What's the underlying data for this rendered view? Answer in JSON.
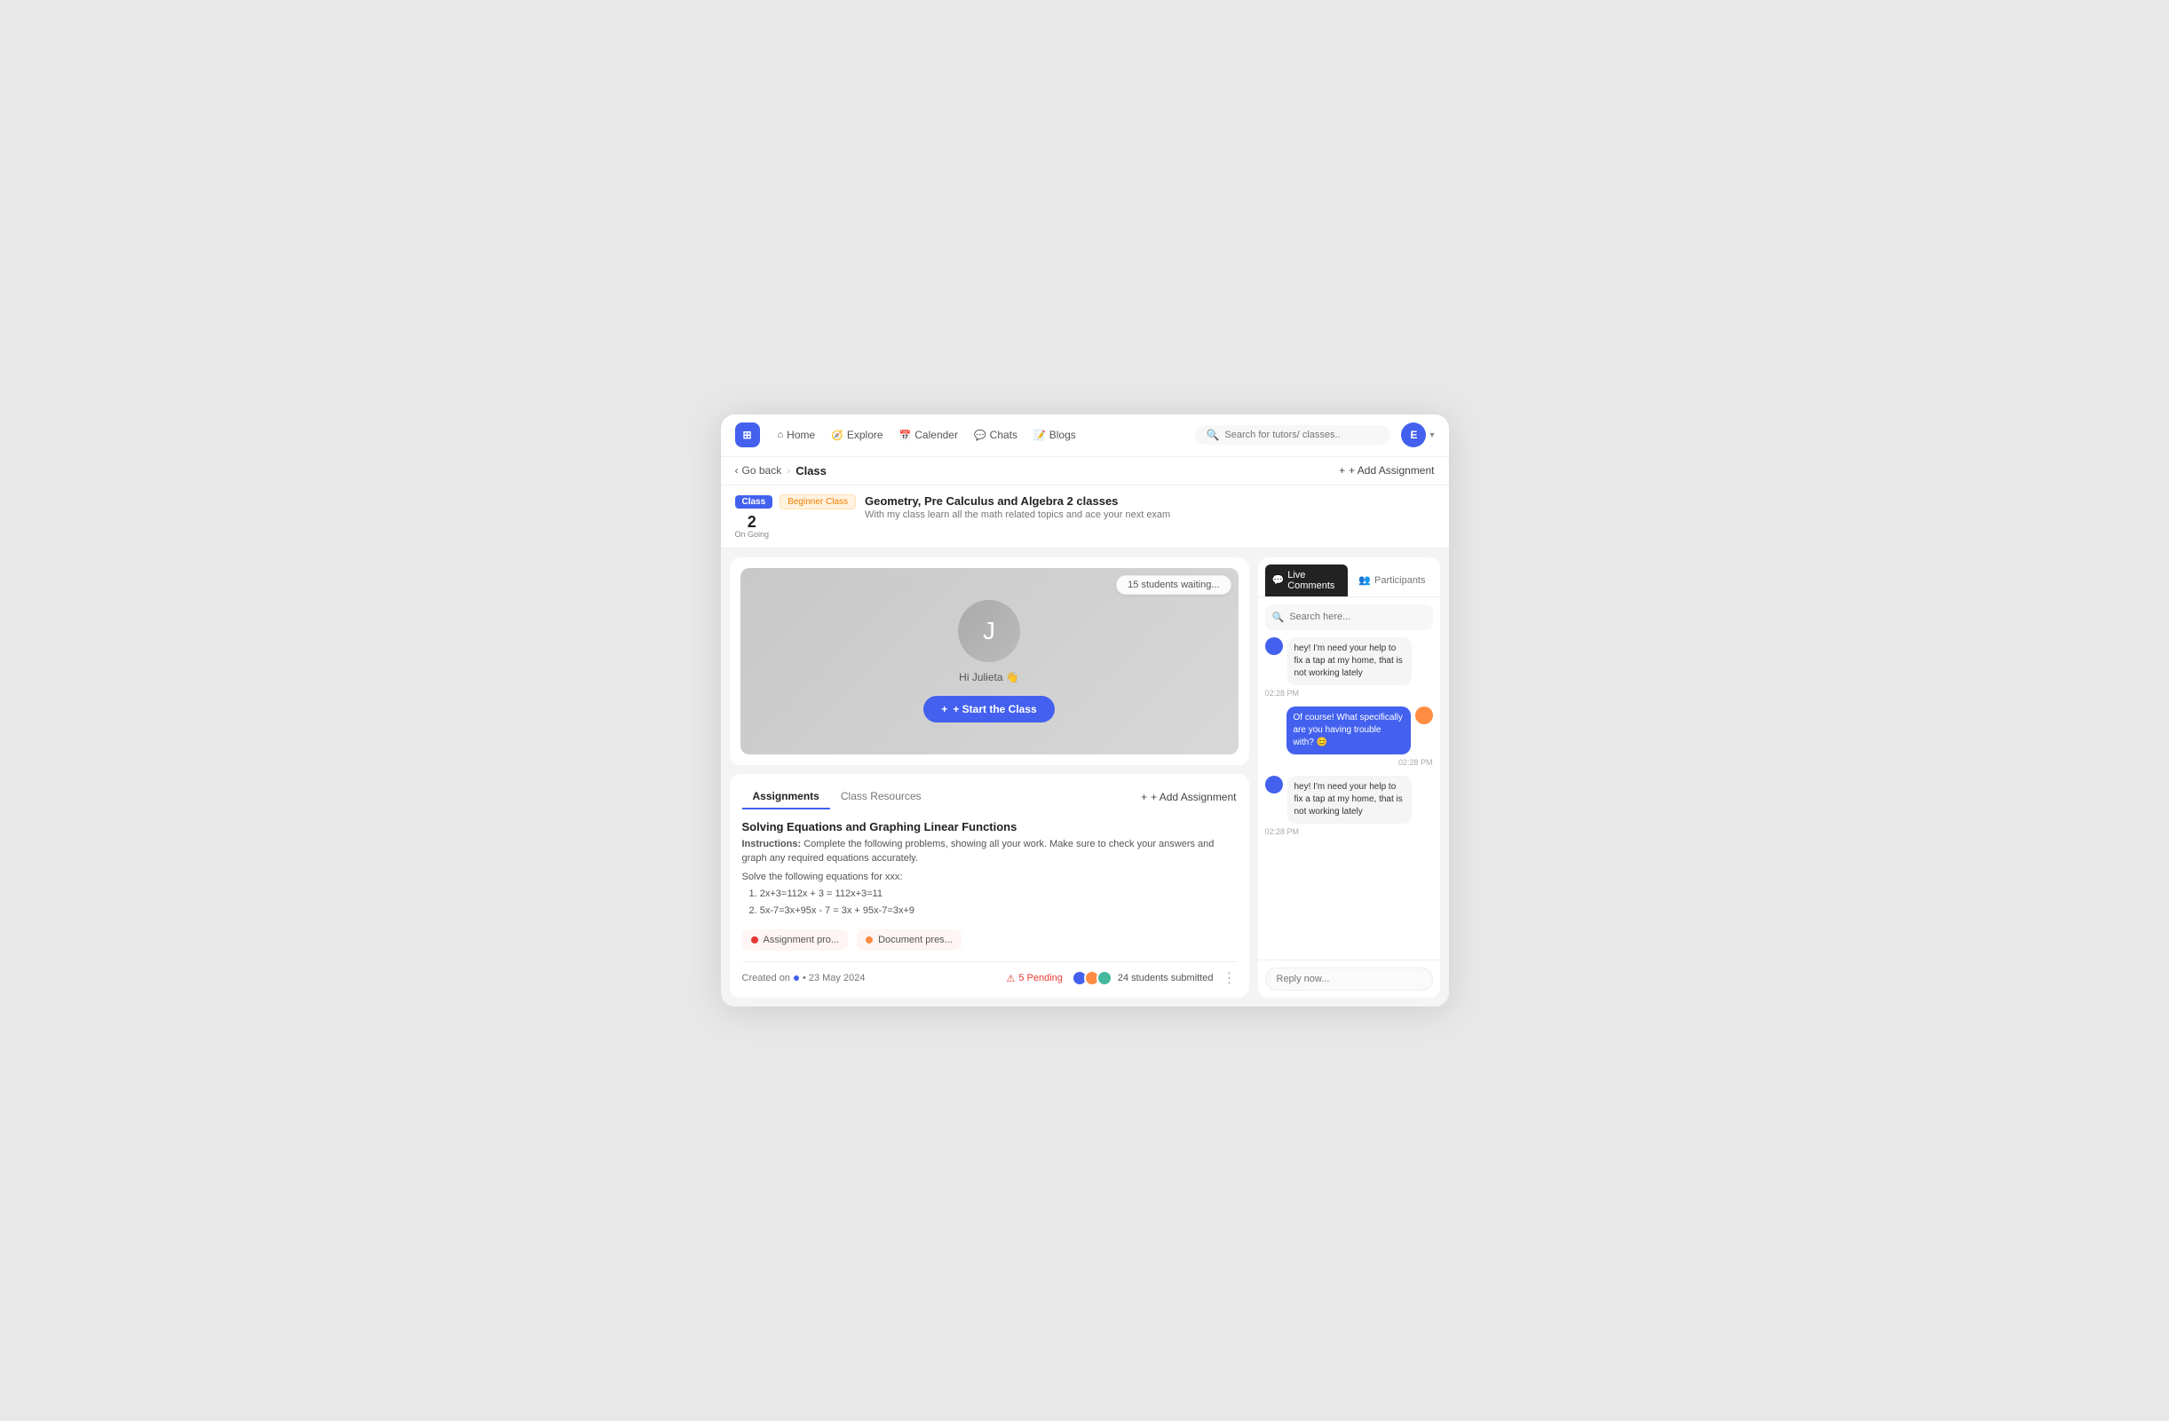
{
  "navbar": {
    "logo": "⊞",
    "links": [
      {
        "id": "home",
        "icon": "⌂",
        "label": "Home"
      },
      {
        "id": "explore",
        "icon": "🧭",
        "label": "Explore"
      },
      {
        "id": "calendar",
        "icon": "📅",
        "label": "Calender"
      },
      {
        "id": "chats",
        "icon": "💬",
        "label": "Chats"
      },
      {
        "id": "blogs",
        "icon": "📝",
        "label": "Blogs"
      }
    ],
    "search_placeholder": "Search for tutors/ classes..",
    "avatar_letter": "E"
  },
  "breadcrumb": {
    "back_label": "Go back",
    "page_label": "Class",
    "add_btn": "+ Add Assignment"
  },
  "class_info": {
    "badge_class": "Class",
    "badge_level": "Beginner Class",
    "date_num": "2",
    "date_status": "On Going",
    "title": "Geometry, Pre Calculus and Algebra 2 classes",
    "description": "With my class learn all the math related topics and ace your next exam"
  },
  "video": {
    "students_badge": "15 students waiting...",
    "avatar_letter": "J",
    "greeting": "Hi Julieta 👋",
    "start_btn": "+ Start the Class"
  },
  "chat": {
    "tab_comments": "Live Comments",
    "tab_participants": "Participants",
    "search_placeholder": "Search here...",
    "messages": [
      {
        "id": 1,
        "side": "left",
        "text": "hey! I'm need your help to fix a tap at my home, that is not working lately",
        "time": "02:28 PM"
      },
      {
        "id": 2,
        "side": "right",
        "text": "Of course! What specifically are you having trouble with? 😊",
        "time": "02:28 PM"
      },
      {
        "id": 3,
        "side": "left",
        "text": "hey! I'm need your help to fix a tap at my home, that is not working lately",
        "time": "02:28 PM"
      }
    ],
    "reply_placeholder": "Reply now..."
  },
  "assignments": {
    "tab_assignments": "Assignments",
    "tab_resources": "Class Resources",
    "add_btn": "+ Add Assignment",
    "card": {
      "title": "Solving Equations and Graphing Linear Functions",
      "instructions_label": "Instructions:",
      "instructions_text": "Complete the following problems, showing all your work. Make sure to check your answers and graph any required equations accurately.",
      "solve_label": "Solve the following equations for xxx:",
      "problems": [
        "1. 2x+3=112x + 3 = 112x+3=11",
        "2. 5x-7=3x+95x - 7 = 3x + 95x-7=3x+9"
      ],
      "attachments": [
        {
          "id": 1,
          "label": "Assignment pro...",
          "dot_color": "red"
        },
        {
          "id": 2,
          "label": "Document pres...",
          "dot_color": "orange"
        }
      ],
      "created_on": "Created on",
      "date": "• 23 May 2024",
      "pending_icon": "⚠",
      "pending_count": "5 Pending",
      "submitted_count": "24 students submitted"
    }
  }
}
